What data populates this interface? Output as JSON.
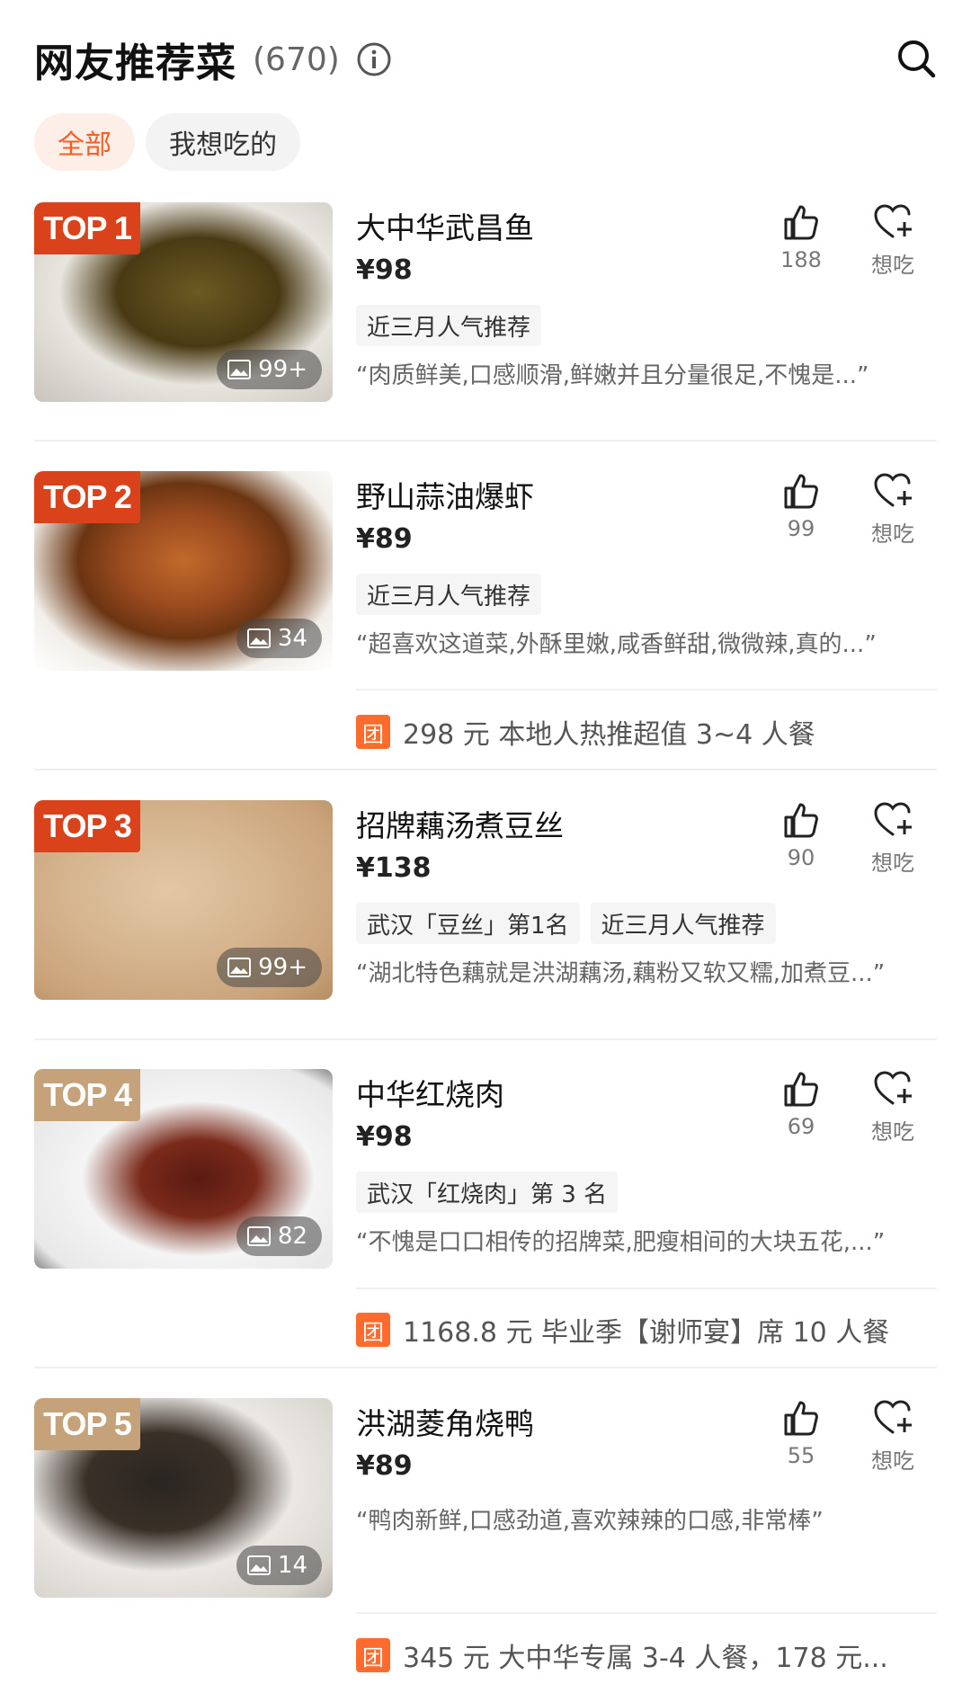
{
  "header": {
    "title": "网友推荐菜",
    "count": "(670)"
  },
  "filters": [
    {
      "label": "全部"
    },
    {
      "label": "我想吃的"
    }
  ],
  "items": [
    {
      "rank": "TOP 1",
      "name": "大中华武昌鱼",
      "price": "¥98",
      "tags": [
        "近三月人气推荐"
      ],
      "quote": "“肉质鲜美,口感顺滑,鲜嫩并且分量很足,不愧是...”",
      "likes": "188",
      "want_label": "想吃",
      "photo_count": "99+"
    },
    {
      "rank": "TOP 2",
      "name": "野山蒜油爆虾",
      "price": "¥89",
      "tags": [
        "近三月人气推荐"
      ],
      "quote": "“超喜欢这道菜,外酥里嫩,咸香鲜甜,微微辣,真的...”",
      "likes": "99",
      "want_label": "想吃",
      "photo_count": "34",
      "deal": {
        "icon": "团",
        "text": "298 元 本地人热推超值 3~4 人餐"
      }
    },
    {
      "rank": "TOP 3",
      "name": "招牌藕汤煮豆丝",
      "price": "¥138",
      "tags": [
        "武汉「豆丝」第1名",
        "近三月人气推荐"
      ],
      "quote": "“湖北特色藕就是洪湖藕汤,藕粉又软又糯,加煮豆...”",
      "likes": "90",
      "want_label": "想吃",
      "photo_count": "99+"
    },
    {
      "rank": "TOP 4",
      "name": "中华红烧肉",
      "price": "¥98",
      "tags": [
        "武汉「红烧肉」第 3 名"
      ],
      "quote": "“不愧是口口相传的招牌菜,肥瘦相间的大块五花,...”",
      "likes": "69",
      "want_label": "想吃",
      "photo_count": "82",
      "deal": {
        "icon": "团",
        "text": "1168.8 元 毕业季【谢师宴】席 10 人餐"
      }
    },
    {
      "rank": "TOP 5",
      "name": "洪湖菱角烧鸭",
      "price": "¥89",
      "tags": [],
      "quote": "“鸭肉新鲜,口感劲道,喜欢辣辣的口感,非常棒”",
      "likes": "55",
      "want_label": "想吃",
      "photo_count": "14",
      "deal": {
        "icon": "团",
        "text": "345 元 大中华专属 3-4 人餐，178 元..."
      }
    }
  ],
  "colors": {
    "accent": "#ff5a1f",
    "badge_red": "#d9421b",
    "badge_tan": "#c6a27a",
    "deal_orange": "#ff6b2d"
  },
  "icons": {
    "info": "info-icon",
    "search": "search-icon",
    "like": "thumbs-up-icon",
    "want": "heart-plus-icon",
    "photos": "image-icon"
  }
}
